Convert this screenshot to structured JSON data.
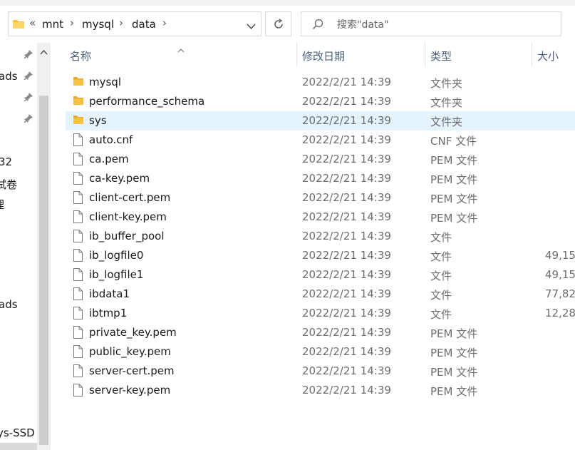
{
  "address_bar": {
    "overflow": "«",
    "crumbs": [
      "mnt",
      "mysql",
      "data"
    ]
  },
  "search": {
    "placeholder": "搜索\"data\""
  },
  "nav_pane": {
    "items": [
      "ads",
      "32",
      "试卷",
      "理",
      "ads",
      "ys-SSD ("
    ]
  },
  "columns": {
    "name": "名称",
    "modified": "修改日期",
    "type": "类型",
    "size": "大小"
  },
  "files": [
    {
      "name": "mysql",
      "modified": "2022/2/21 14:39",
      "type": "文件夹",
      "size": "",
      "icon": "folder-icon"
    },
    {
      "name": "performance_schema",
      "modified": "2022/2/21 14:39",
      "type": "文件夹",
      "size": "",
      "icon": "folder-icon"
    },
    {
      "name": "sys",
      "modified": "2022/2/21 14:39",
      "type": "文件夹",
      "size": "",
      "icon": "folder-icon"
    },
    {
      "name": "auto.cnf",
      "modified": "2022/2/21 14:39",
      "type": "CNF 文件",
      "size": "",
      "icon": "file-icon"
    },
    {
      "name": "ca.pem",
      "modified": "2022/2/21 14:39",
      "type": "PEM 文件",
      "size": "",
      "icon": "file-icon"
    },
    {
      "name": "ca-key.pem",
      "modified": "2022/2/21 14:39",
      "type": "PEM 文件",
      "size": "",
      "icon": "file-icon"
    },
    {
      "name": "client-cert.pem",
      "modified": "2022/2/21 14:39",
      "type": "PEM 文件",
      "size": "",
      "icon": "file-icon"
    },
    {
      "name": "client-key.pem",
      "modified": "2022/2/21 14:39",
      "type": "PEM 文件",
      "size": "",
      "icon": "file-icon"
    },
    {
      "name": "ib_buffer_pool",
      "modified": "2022/2/21 14:39",
      "type": "文件",
      "size": "",
      "icon": "file-icon"
    },
    {
      "name": "ib_logfile0",
      "modified": "2022/2/21 14:39",
      "type": "文件",
      "size": "49,15",
      "icon": "file-icon"
    },
    {
      "name": "ib_logfile1",
      "modified": "2022/2/21 14:39",
      "type": "文件",
      "size": "49,15",
      "icon": "file-icon"
    },
    {
      "name": "ibdata1",
      "modified": "2022/2/21 14:39",
      "type": "文件",
      "size": "77,82",
      "icon": "file-icon"
    },
    {
      "name": "ibtmp1",
      "modified": "2022/2/21 14:39",
      "type": "文件",
      "size": "12,28",
      "icon": "file-icon"
    },
    {
      "name": "private_key.pem",
      "modified": "2022/2/21 14:39",
      "type": "PEM 文件",
      "size": "",
      "icon": "file-icon"
    },
    {
      "name": "public_key.pem",
      "modified": "2022/2/21 14:39",
      "type": "PEM 文件",
      "size": "",
      "icon": "file-icon"
    },
    {
      "name": "server-cert.pem",
      "modified": "2022/2/21 14:39",
      "type": "PEM 文件",
      "size": "",
      "icon": "file-icon"
    },
    {
      "name": "server-key.pem",
      "modified": "2022/2/21 14:39",
      "type": "PEM 文件",
      "size": "",
      "icon": "file-icon"
    }
  ],
  "selected_file": "sys",
  "colors": {
    "folder": "#f5c242",
    "selected_row": "#e5f3ff",
    "header_text": "#4c607a"
  }
}
